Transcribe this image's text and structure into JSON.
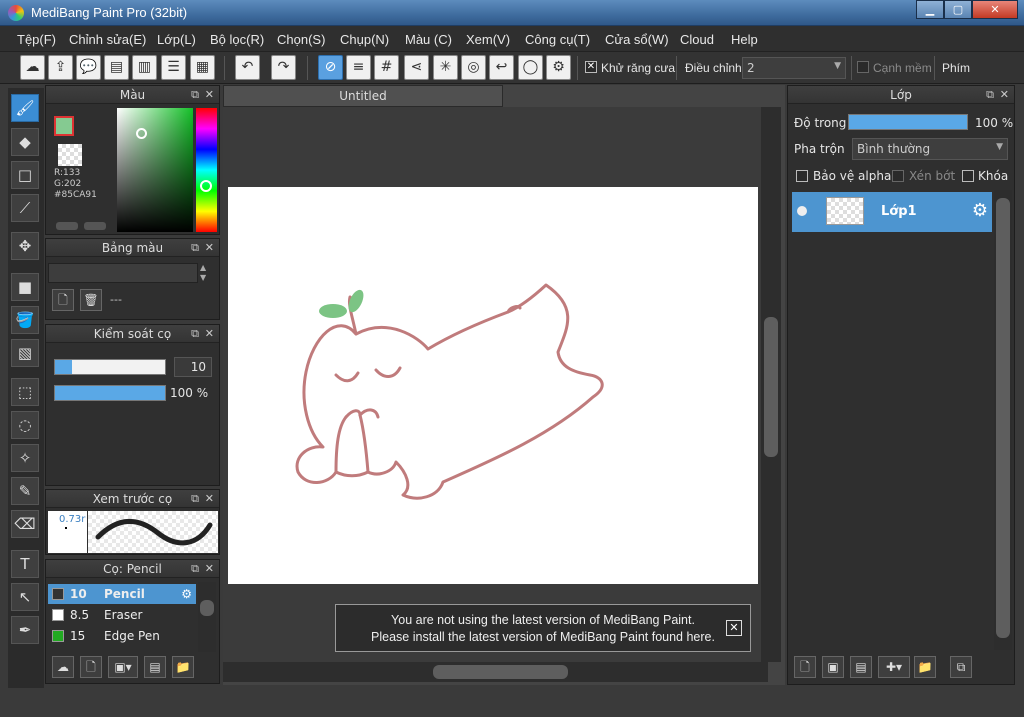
{
  "window": {
    "title": "MediBang Paint Pro (32bit)"
  },
  "menu": [
    "Tệp(F)",
    "Chỉnh sửa(E)",
    "Lớp(L)",
    "Bộ lọc(R)",
    "Chọn(S)",
    "Chụp(N)",
    "Màu (C)",
    "Xem(V)",
    "Công cụ(T)",
    "Cửa sổ(W)",
    "Cloud",
    "Help"
  ],
  "toolbar": {
    "antialias_label": "Khử răng cưa",
    "adjust_label": "Điều chỉnh",
    "adjust_value": "2",
    "soft_edge_label": "Cạnh mềm",
    "keys_label": "Phím"
  },
  "color_panel": {
    "title": "Màu",
    "r": "R:133",
    "g": "G:202",
    "hex": "#85CA91",
    "fg_color": "#85CA91"
  },
  "palette_panel": {
    "title": "Bảng màu",
    "name": "---"
  },
  "brush_control": {
    "title": "Kiểm soát cọ",
    "size": "10",
    "opacity": "100 %",
    "size_fraction": 0.15,
    "opacity_fraction": 1.0
  },
  "brush_preview": {
    "title": "Xem trước cọ",
    "size": "0.73r"
  },
  "brush_list": {
    "title": "Cọ: Pencil",
    "items": [
      {
        "size": "10",
        "name": "Pencil",
        "color": "#333333"
      },
      {
        "size": "8.5",
        "name": "Eraser",
        "color": "#ffffff"
      },
      {
        "size": "15",
        "name": "Edge Pen",
        "color": "#22aa22"
      }
    ]
  },
  "document": {
    "tab": "Untitled"
  },
  "notice": {
    "line1": "You are not using the latest version of MediBang Paint.",
    "line2": "Please install the latest version of MediBang Paint found here."
  },
  "layer_panel": {
    "title": "Lớp",
    "opacity_label": "Độ trong",
    "opacity_value": "100 %",
    "blend_label": "Pha trộn",
    "blend_value": "Bình thường",
    "protect_alpha": "Bảo vệ alpha",
    "clip": "Xén bớt",
    "lock": "Khóa",
    "layers": [
      {
        "name": "Lớp1"
      }
    ]
  }
}
